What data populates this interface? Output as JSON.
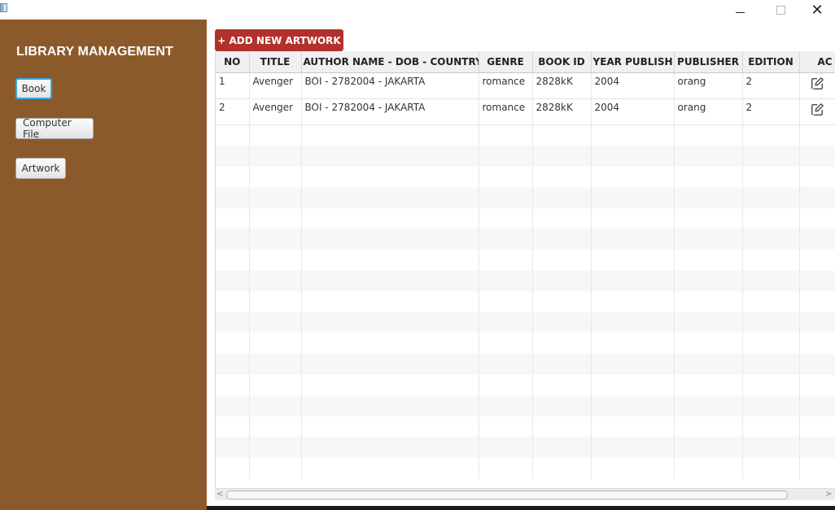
{
  "window": {
    "minimize": "—",
    "maximize": "□",
    "close": "✕"
  },
  "sidebar": {
    "title": "LIBRARY MANAGEMENT",
    "items": [
      {
        "label": "Book",
        "active": true
      },
      {
        "label": "Computer File",
        "active": false
      },
      {
        "label": "Artwork",
        "active": false
      }
    ]
  },
  "main": {
    "add_button": "+ ADD NEW ARTWORK",
    "table": {
      "columns": [
        "NO",
        "TITLE",
        "AUTHOR NAME - DOB - COUNTRY",
        "GENRE",
        "BOOK ID",
        "YEAR PUBLISH",
        "PUBLISHER",
        "EDITION",
        "AC"
      ],
      "rows": [
        [
          "1",
          "Avenger",
          "BOI - 2782004 - JAKARTA",
          "romance",
          "2828kK",
          "2004",
          "orang",
          "2"
        ],
        [
          "2",
          "Avenger",
          "BOI - 2782004 - JAKARTA",
          "romance",
          "2828kK",
          "2004",
          "orang",
          "2"
        ]
      ],
      "action_icon": "edit-icon"
    },
    "scrollbar": {
      "left_arrow": "<",
      "right_arrow": ">"
    }
  },
  "colors": {
    "sidebar": "#8b5a2b",
    "add_button": "#b3312c",
    "active_border": "#39a8df"
  }
}
